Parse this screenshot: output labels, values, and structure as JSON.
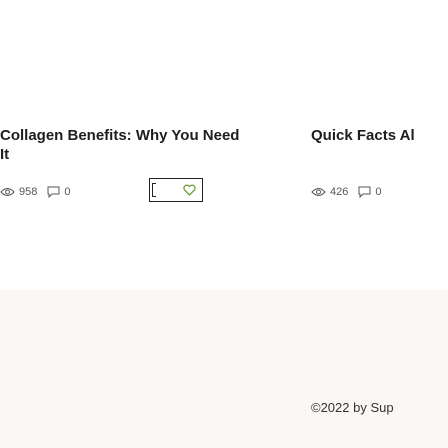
{
  "cards": [
    {
      "title": "Collagen Benefits: Why You Need It",
      "views": "958",
      "comments": "0"
    },
    {
      "title": "Quick Facts Al",
      "views": "426",
      "comments": "0"
    }
  ],
  "footer": {
    "copyright": "©2022 by Sup"
  },
  "icons": {
    "views": "eye-icon",
    "comments": "comment-icon",
    "share": "heart-icon"
  },
  "colors": {
    "footer_background": "#fbf7f4",
    "accent": "#6c9d3a"
  }
}
